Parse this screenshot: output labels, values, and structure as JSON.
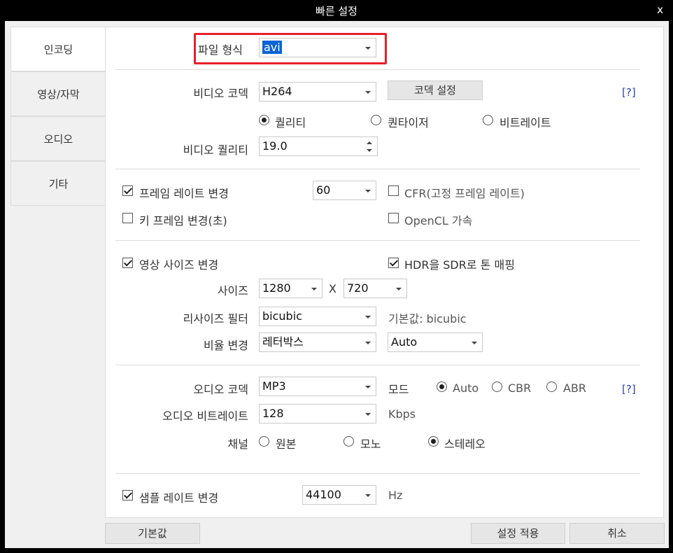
{
  "window": {
    "title": "빠른 설정",
    "close": "x"
  },
  "sidebar": {
    "items": [
      {
        "label": "인코딩"
      },
      {
        "label": "영상/자막"
      },
      {
        "label": "오디오"
      },
      {
        "label": "기타"
      }
    ]
  },
  "file_format": {
    "label": "파일 형식",
    "value": "avi"
  },
  "video": {
    "codec_label": "비디오 코덱",
    "codec_value": "H264",
    "codec_settings_button": "코덱 설정",
    "help": "[?]",
    "mode_options": [
      "퀄리티",
      "퀀타이저",
      "비트레이트"
    ],
    "quality_label": "비디오 퀄리티",
    "quality_value": "19.0"
  },
  "framerate": {
    "change_label": "프레임 레이트 변경",
    "change_checked": true,
    "value": "60",
    "cfr_label": "CFR(고정 프레임 레이트)",
    "cfr_checked": false,
    "keyframe_label": "키 프레임 변경(초)",
    "keyframe_checked": false,
    "opencl_label": "OpenCL 가속",
    "opencl_checked": false
  },
  "resize": {
    "change_label": "영상 사이즈 변경",
    "change_checked": true,
    "hdr_label": "HDR을 SDR로 톤 매핑",
    "hdr_checked": true,
    "size_label": "사이즈",
    "width": "1280",
    "x": "X",
    "height": "720",
    "filter_label": "리사이즈 필터",
    "filter_value": "bicubic",
    "filter_default": "기본값: bicubic",
    "ratio_label": "비율 변경",
    "ratio_value": "레터박스",
    "ratio_auto": "Auto"
  },
  "audio": {
    "codec_label": "오디오 코덱",
    "codec_value": "MP3",
    "mode_label": "모드",
    "mode_options": [
      "Auto",
      "CBR",
      "ABR"
    ],
    "help": "[?]",
    "bitrate_label": "오디오 비트레이트",
    "bitrate_value": "128",
    "bitrate_unit": "Kbps",
    "channel_label": "채널",
    "channel_options": [
      "원본",
      "모노",
      "스테레오"
    ],
    "samplerate_label": "샘플 레이트 변경",
    "samplerate_checked": true,
    "samplerate_value": "44100",
    "samplerate_unit": "Hz"
  },
  "footer": {
    "default_button": "기본값",
    "apply_button": "설정 적용",
    "cancel_button": "취소"
  }
}
